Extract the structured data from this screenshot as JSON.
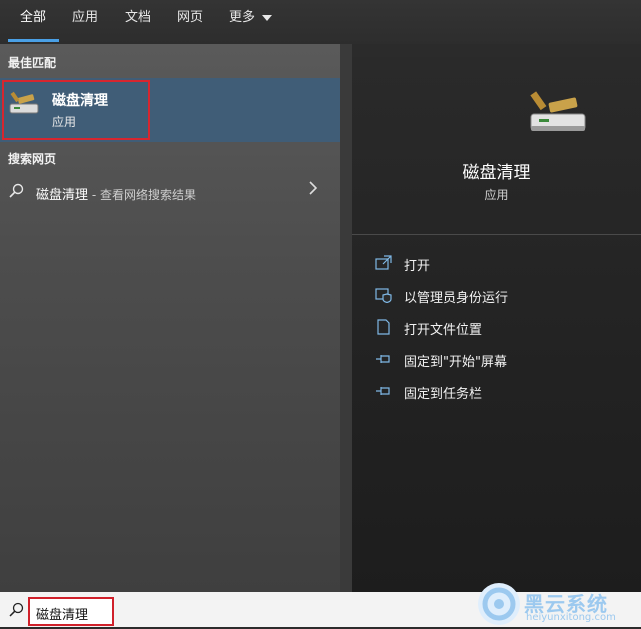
{
  "tabs": [
    {
      "label": "全部",
      "active": true
    },
    {
      "label": "应用"
    },
    {
      "label": "文档"
    },
    {
      "label": "网页"
    },
    {
      "label": "更多"
    }
  ],
  "sections": {
    "best_match": "最佳匹配",
    "web_search": "搜索网页"
  },
  "best_match": {
    "title": "磁盘清理",
    "subtitle": "应用",
    "icon": "disk-cleanup-icon"
  },
  "web_result": {
    "query": "磁盘清理",
    "suffix": " - 查看网络搜索结果"
  },
  "preview": {
    "title": "磁盘清理",
    "subtitle": "应用",
    "actions": [
      {
        "label": "打开",
        "icon": "open-icon"
      },
      {
        "label": "以管理员身份运行",
        "icon": "admin-shield-icon"
      },
      {
        "label": "打开文件位置",
        "icon": "file-location-icon"
      },
      {
        "label": "固定到\"开始\"屏幕",
        "icon": "pin-icon"
      },
      {
        "label": "固定到任务栏",
        "icon": "pin-icon"
      }
    ]
  },
  "search": {
    "value": "磁盘清理"
  },
  "watermark": {
    "name": "黑云系统",
    "url": "heiyunxitong.com"
  },
  "colors": {
    "accent": "#4aa0e6",
    "highlight_border": "#d8262f",
    "selected_bg": "#405d77"
  }
}
